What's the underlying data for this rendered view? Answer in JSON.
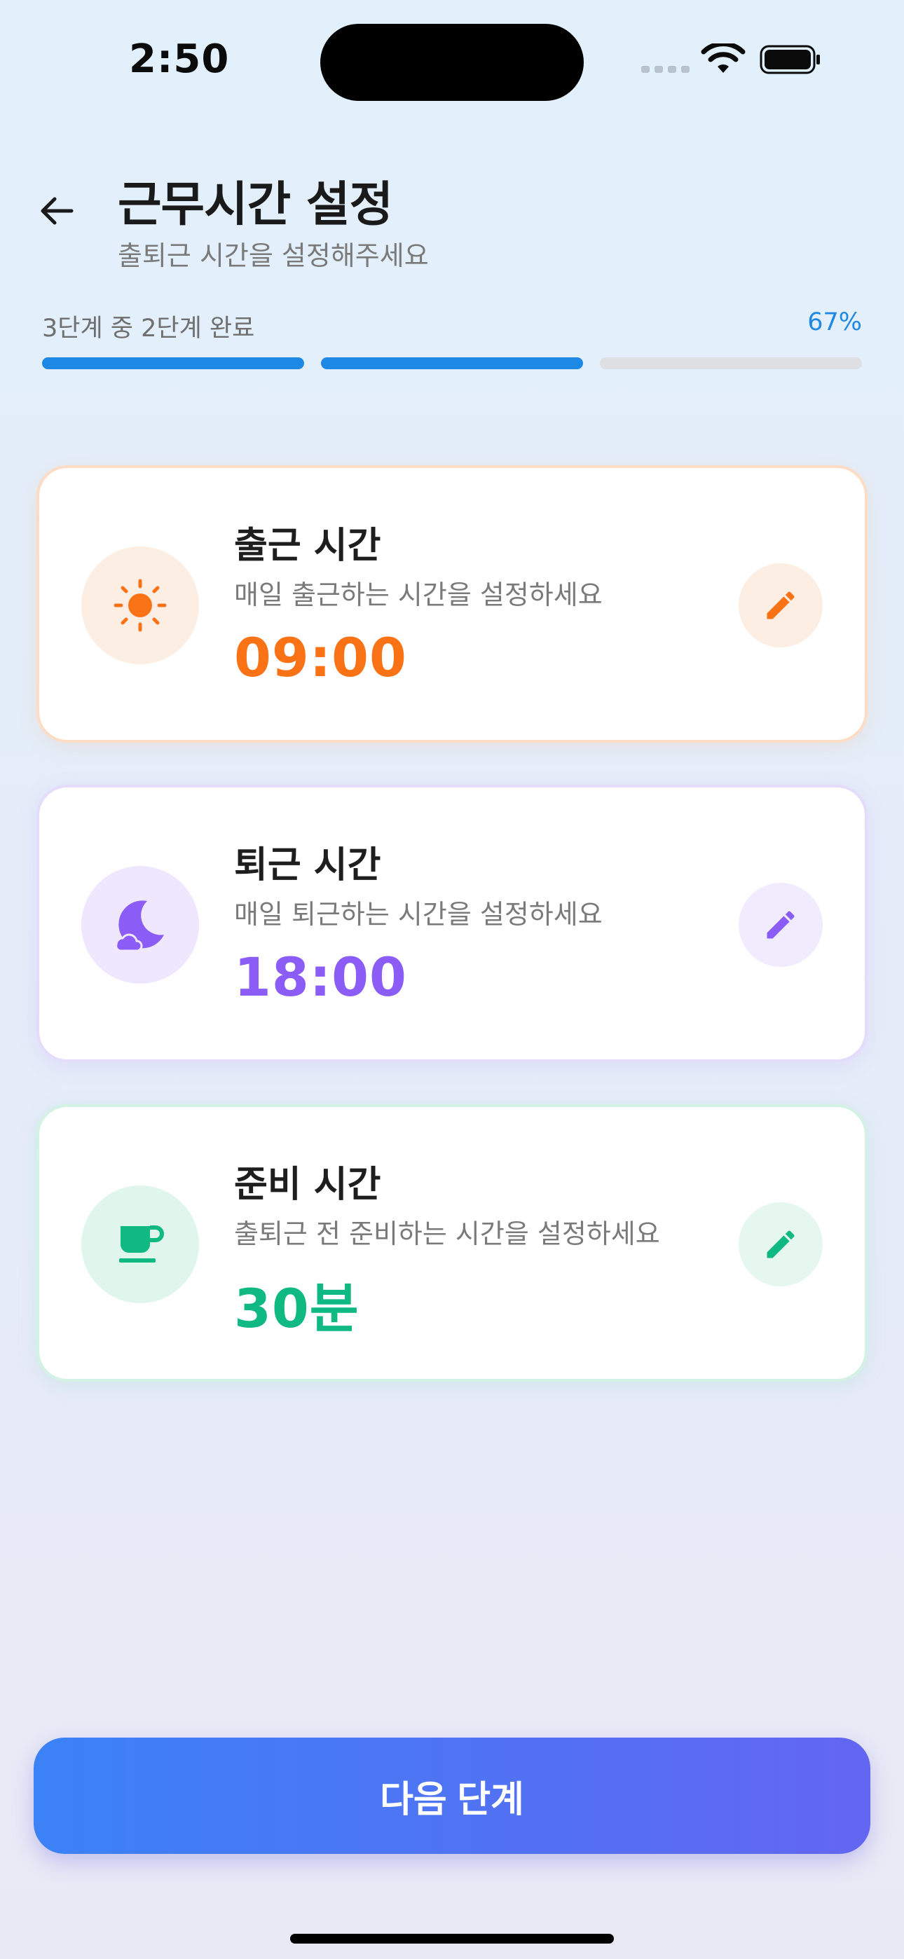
{
  "status_bar": {
    "time": "2:50"
  },
  "header": {
    "title": "근무시간 설정",
    "subtitle": "출퇴근 시간을 설정해주세요"
  },
  "progress": {
    "label": "3단계 중 2단계 완료",
    "percent_text": "67%",
    "steps_total": 3,
    "steps_done": 2
  },
  "cards": [
    {
      "title": "출근 시간",
      "description": "매일 출근하는 시간을 설정하세요",
      "value": "09:00",
      "icon": "sun-icon",
      "accent": "#f97316"
    },
    {
      "title": "퇴근 시간",
      "description": "매일 퇴근하는 시간을 설정하세요",
      "value": "18:00",
      "icon": "moon-icon",
      "accent": "#8b5cf6"
    },
    {
      "title": "준비 시간",
      "description": "출퇴근 전 준비하는 시간을 설정하세요",
      "value": "30분",
      "icon": "coffee-icon",
      "accent": "#10b981"
    }
  ],
  "footer": {
    "next_label": "다음 단계"
  },
  "colors": {
    "primary": "#1e88e5",
    "button_start": "#3b82f6",
    "button_end": "#6366f1"
  }
}
